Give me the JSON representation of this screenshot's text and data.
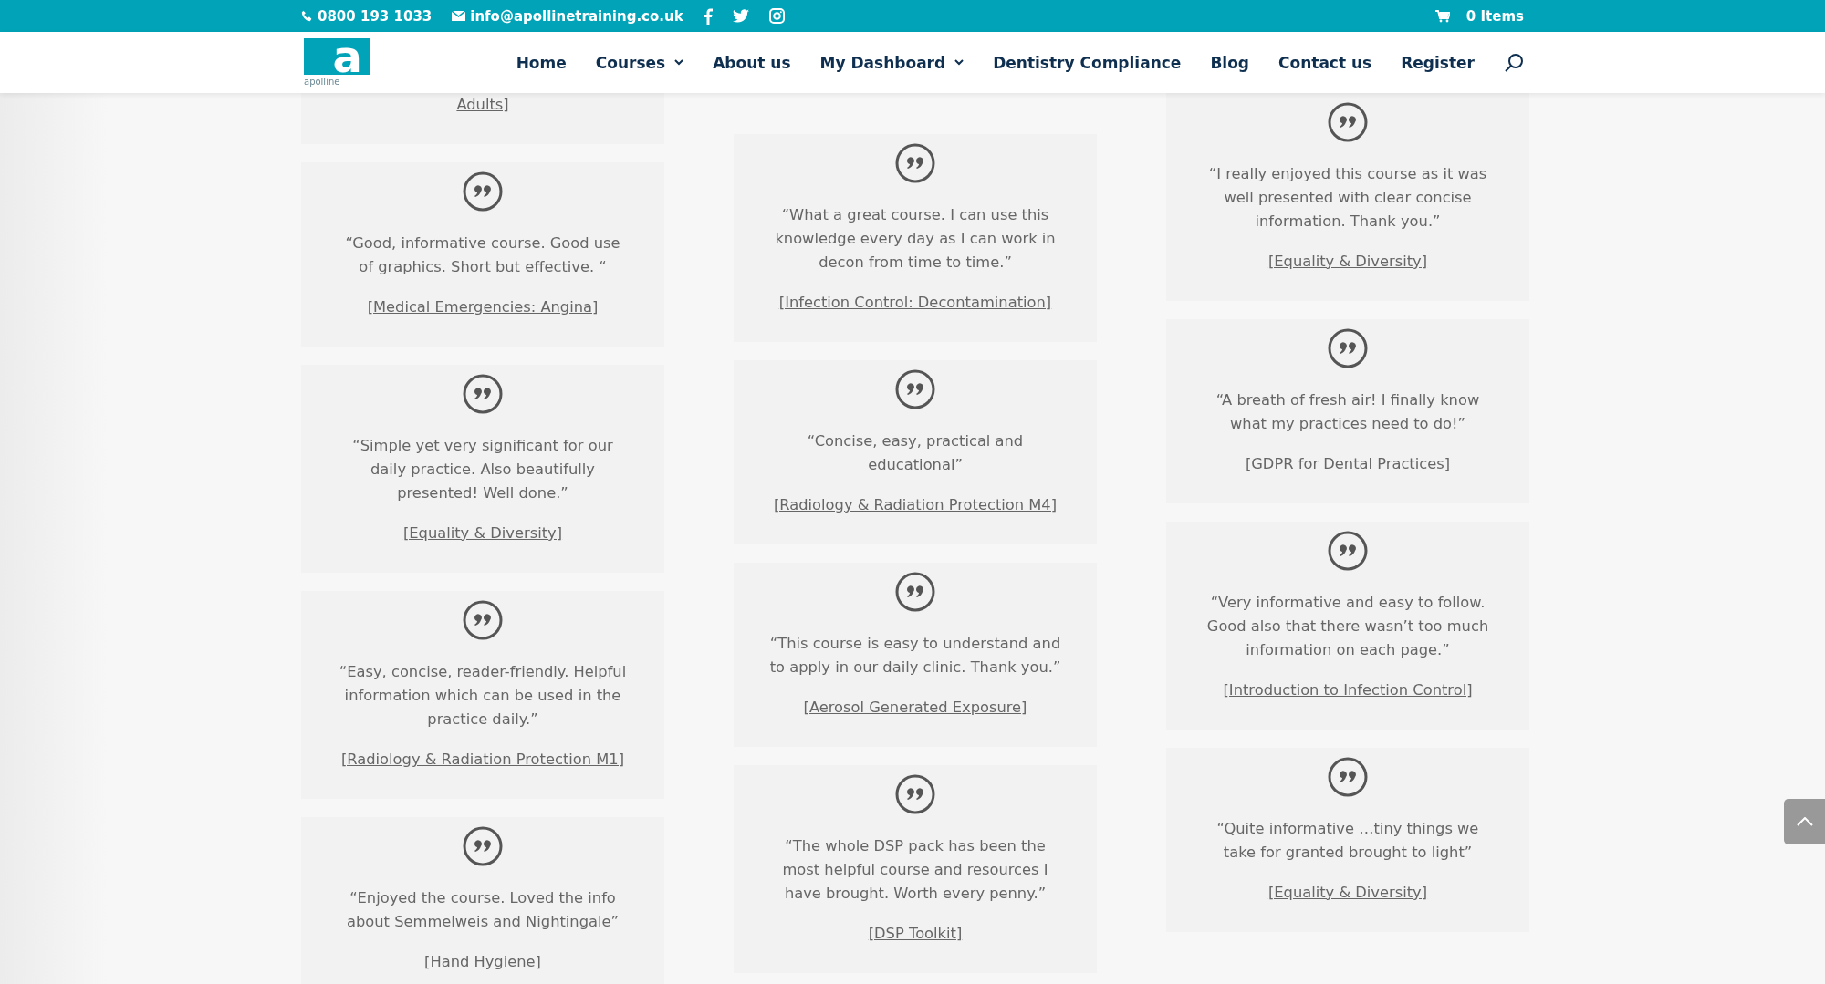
{
  "top_bar": {
    "phone": "0800 193 1033",
    "email": "info@apollinetraining.co.uk",
    "cart": "0 Items"
  },
  "logo": {
    "mark": "a",
    "name": "apolline"
  },
  "nav": [
    {
      "label": "Home",
      "dropdown": false
    },
    {
      "label": "Courses",
      "dropdown": true
    },
    {
      "label": "About us",
      "dropdown": false
    },
    {
      "label": "My Dashboard",
      "dropdown": true
    },
    {
      "label": "Dentistry Compliance",
      "dropdown": false
    },
    {
      "label": "Blog",
      "dropdown": false
    },
    {
      "label": "Contact us",
      "dropdown": false
    },
    {
      "label": "Register",
      "dropdown": false
    }
  ],
  "columns": [
    {
      "partial_link": "Adults]",
      "testimonials": [
        {
          "quote": "“Good, informative course. Good use of graphics. Short but effective. “",
          "course": "[Medical Emergencies: Angina]",
          "linked": true
        },
        {
          "quote": "“Simple yet very significant for our daily practice. Also beautifully presented! Well done.”",
          "course": "[Equality & Diversity]",
          "linked": true
        },
        {
          "quote": "“Easy, concise, reader-friendly. Helpful information which can be used in the practice daily.”",
          "course": "[Radiology & Radiation Protection M1]",
          "linked": true
        },
        {
          "quote": "“Enjoyed the course. Loved the info about Semmelweis and Nightingale”",
          "course": "[Hand Hygiene]",
          "linked": true
        }
      ]
    },
    {
      "testimonials": [
        {
          "quote": "“What a great course. I can use this knowledge every day as I can work in decon from time to time.”",
          "course": "[Infection Control: Decontamination]",
          "linked": true
        },
        {
          "quote": "“Concise, easy, practical and educational”",
          "course": "[Radiology & Radiation Protection M4]",
          "linked": true
        },
        {
          "quote": "“This course is easy to understand and to apply in our daily clinic. Thank you.”",
          "course": "[Aerosol Generated Exposure]",
          "linked": true
        },
        {
          "quote": "“The whole DSP pack has been the most helpful course and resources I have brought. Worth every penny.”",
          "course": "[DSP Toolkit]",
          "linked": true
        }
      ]
    },
    {
      "testimonials": [
        {
          "quote": "“I really enjoyed this course as it was well presented with clear concise information. Thank you.”",
          "course": "[Equality & Diversity]",
          "linked": true
        },
        {
          "quote": "“A breath of fresh air! I finally know what my practices need to do!”",
          "course": "[GDPR for Dental Practices]",
          "linked": false
        },
        {
          "quote": "“Very informative and easy to follow. Good also that there wasn’t too much information on each page.”",
          "course": "[Introduction to Infection Control]",
          "linked": true
        },
        {
          "quote": "“Quite informative …tiny things we take for granted brought to light”",
          "course": "[Equality & Diversity]",
          "linked": true
        }
      ]
    }
  ]
}
